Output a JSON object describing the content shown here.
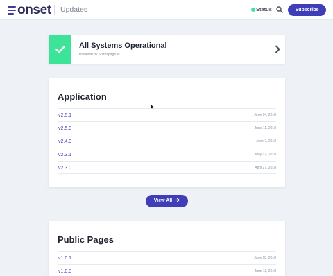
{
  "header": {
    "logo_text": "onset",
    "page_name": "Updates",
    "status_label": "Status",
    "subscribe_label": "Subscribe",
    "status_color": "#3ee39a",
    "accent_color": "#3f3db8",
    "icons": {
      "logo": "menu-lines-icon",
      "search": "search-icon"
    }
  },
  "status_banner": {
    "title": "All Systems Operational",
    "powered_by": "Powered by Statuspage.io",
    "icons": {
      "check": "check-icon",
      "chevron": "chevron-right-icon"
    }
  },
  "sections": [
    {
      "title": "Application",
      "releases": [
        {
          "version": "v2.5.1",
          "date": "June 14, 2018"
        },
        {
          "version": "v2.5.0",
          "date": "June 11, 2018"
        },
        {
          "version": "v2.4.0",
          "date": "June 7, 2018"
        },
        {
          "version": "v2.3.1",
          "date": "May 17, 2018"
        },
        {
          "version": "v2.3.0",
          "date": "April 27, 2018"
        }
      ],
      "view_all_label": "View All"
    },
    {
      "title": "Public Pages",
      "releases": [
        {
          "version": "v1.0.1",
          "date": "June 18, 2018"
        },
        {
          "version": "v1.0.0",
          "date": "June 11, 2018"
        }
      ]
    }
  ]
}
